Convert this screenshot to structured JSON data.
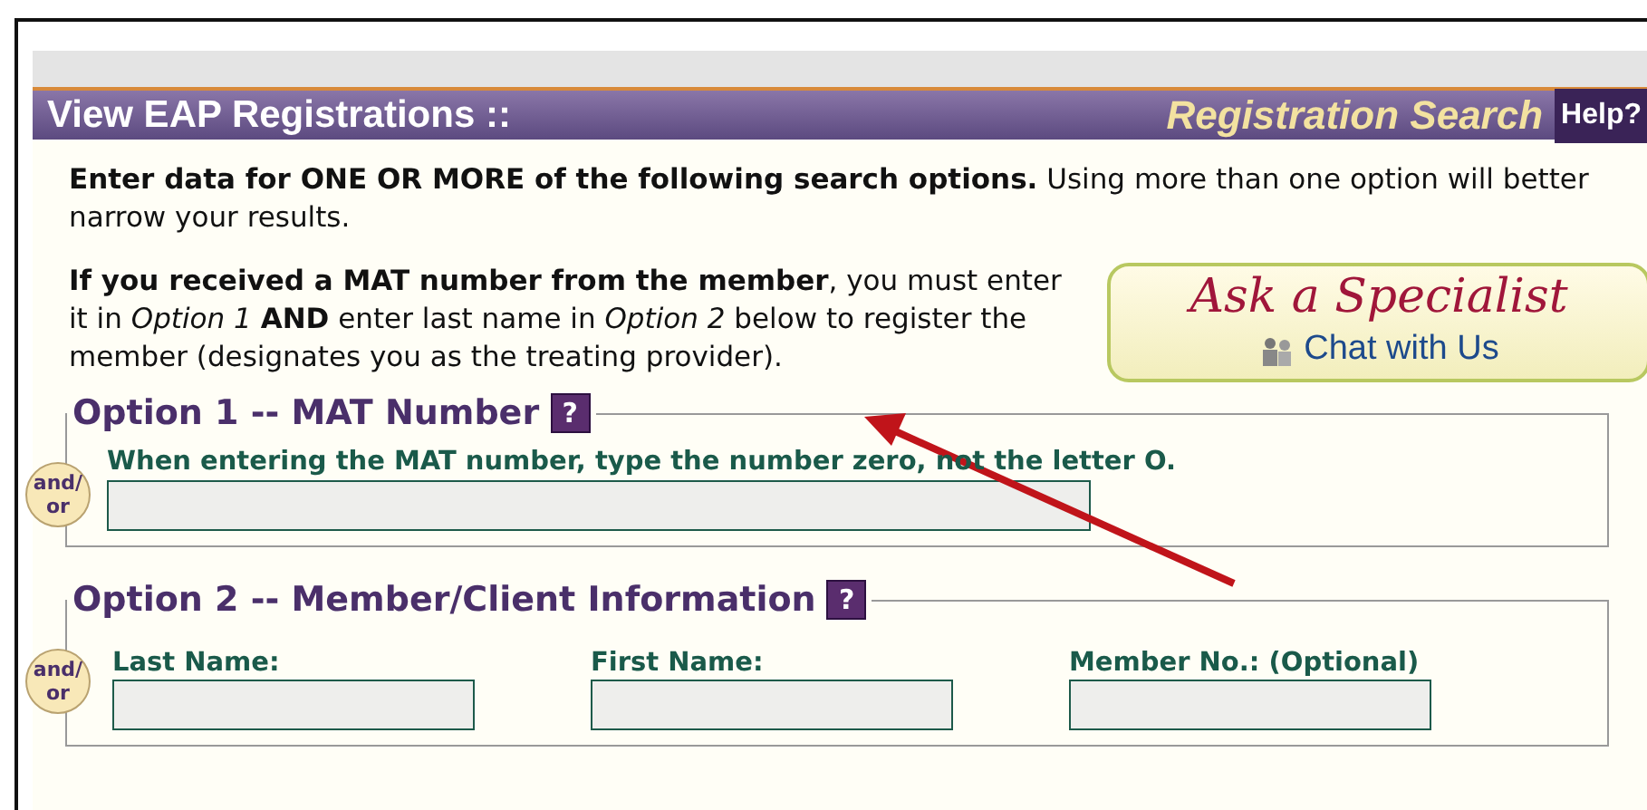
{
  "header": {
    "title": "View EAP Registrations ::",
    "subtitle": "Registration Search",
    "help": "Help?"
  },
  "intro": "**Enter data for ONE OR MORE of the following search options.** Using more than one option will better narrow your results.",
  "note": "**If you received a MAT number from the member**, you must enter it in *Option 1* **AND** enter last name in *Option 2* below to register the member (designates you as the treating provider).",
  "specialist": {
    "title": "Ask a Specialist",
    "link": "Chat with Us"
  },
  "options": [
    {
      "title": "Option 1 -- MAT Number",
      "help": "?",
      "connector": [
        "and/",
        "or"
      ],
      "kind": "single",
      "fields": [
        {
          "label": "When entering the MAT number, type the number zero, not the letter O."
        }
      ]
    },
    {
      "title": "Option 2 -- Member/Client Information",
      "help": "?",
      "connector": [
        "and/",
        "or"
      ],
      "kind": "columns",
      "fields": [
        {
          "label": "Last Name:"
        },
        {
          "label": "First Name:"
        },
        {
          "label": "Member No.: (Optional)"
        }
      ]
    }
  ]
}
